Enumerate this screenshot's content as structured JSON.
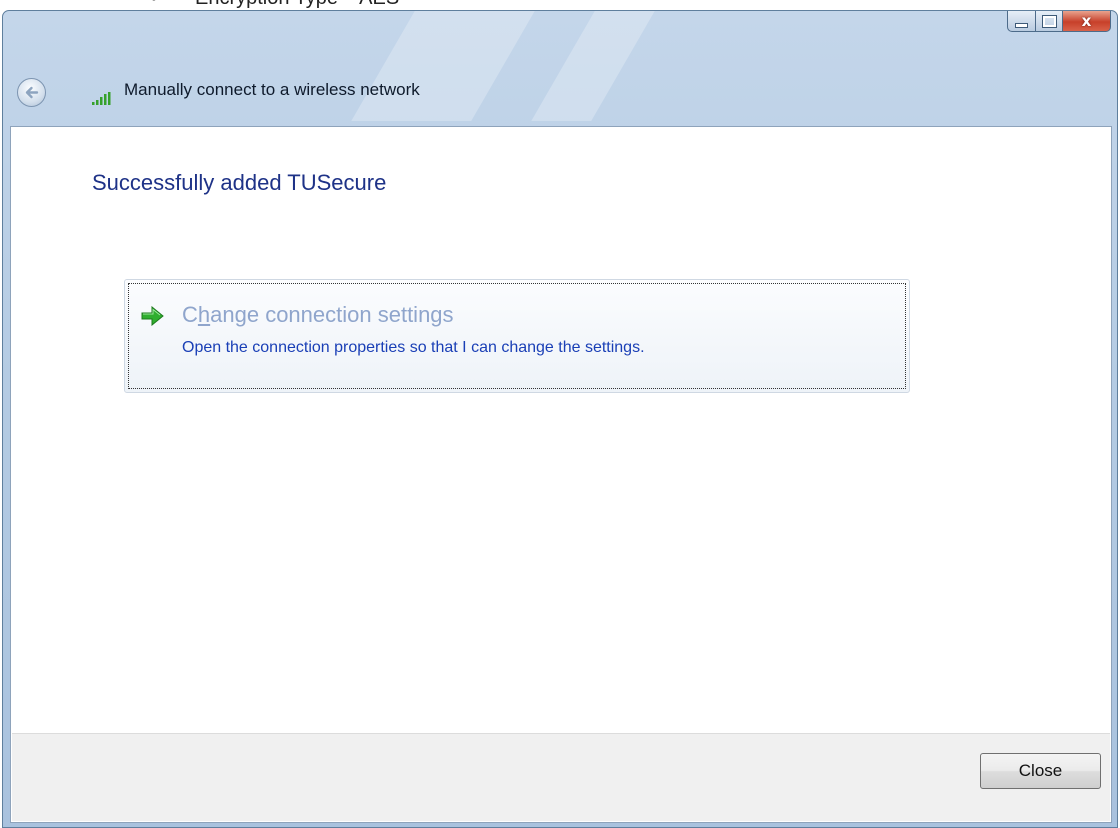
{
  "background_doc": {
    "bullet": "•",
    "text": "Encryption Type – AES"
  },
  "window": {
    "caption_buttons": {
      "minimize": "minimize-icon",
      "maximize": "maximize-icon",
      "close": "close-icon",
      "close_glyph": "x"
    },
    "nav": {
      "title": "Manually connect to a wireless network",
      "back_icon": "back-arrow-icon",
      "network_icon": "wireless-signal-icon"
    },
    "main": {
      "heading": "Successfully added TUSecure",
      "command_link": {
        "title_before": "C",
        "title_accel": "h",
        "title_after": "ange connection settings",
        "description": "Open the connection properties so that I can change the settings.",
        "icon": "green-arrow-icon"
      }
    },
    "footer": {
      "close_label": "Close"
    }
  },
  "colors": {
    "heading": "#1e3287",
    "link_title": "#8fa5cc",
    "link_desc": "#1a3fb6",
    "frame": "#b4cbe3",
    "close_button": "#c7402a"
  }
}
